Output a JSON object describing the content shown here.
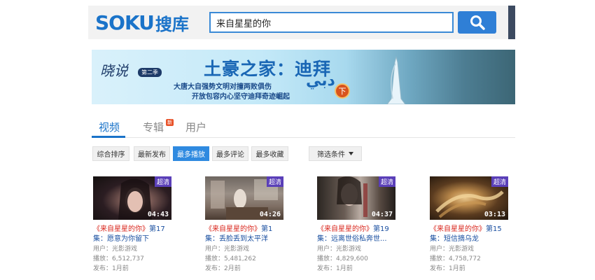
{
  "header": {
    "logo_latin": "SOKU",
    "logo_cn": "搜库",
    "search_value": "来自星星的你"
  },
  "banner": {
    "brand": "晓说",
    "badge": "第二季",
    "title": "土豪之家：迪拜",
    "line1": "大唐大自强势文明对撞两败俱伤",
    "line2": "开放包容内心坚守迪拜奇迹崛起",
    "arabic": "دبي",
    "down_label": "下"
  },
  "tabs": [
    {
      "label": "视频"
    },
    {
      "label": "专辑"
    },
    {
      "label": "用户"
    }
  ],
  "tab_badge": "新",
  "sort": [
    {
      "label": "综合排序"
    },
    {
      "label": "最新发布"
    },
    {
      "label": "最多播放"
    },
    {
      "label": "最多评论"
    },
    {
      "label": "最多收藏"
    }
  ],
  "filter_label": "筛选条件",
  "videos": [
    {
      "hd": "超清",
      "duration": "04:43",
      "title_hl": "《来自星星的你》",
      "title_rest": "第17集：愿意为你留下",
      "user": "用户：光影游戏",
      "plays": "播放：6,512,737",
      "published": "发布：1月前"
    },
    {
      "hd": "超清",
      "duration": "04:26",
      "title_hl": "《来自星星的你》",
      "title_rest": "第1集：丢脸丢到太平洋",
      "user": "用户：光影游戏",
      "plays": "播放：5,481,262",
      "published": "发布：2月前"
    },
    {
      "hd": "超清",
      "duration": "04:37",
      "title_hl": "《来自星星的你》",
      "title_rest": "第19集：远离世俗私奔世...",
      "user": "用户：光影游戏",
      "plays": "播放：4,829,600",
      "published": "发布：1月前"
    },
    {
      "hd": "超清",
      "duration": "03:13",
      "title_hl": "《来自星星的你》",
      "title_rest": "第15集：短信摘乌龙",
      "user": "用户：光影游戏",
      "plays": "播放：4,758,772",
      "published": "发布：1月前"
    }
  ],
  "colors": {
    "brand": "#1a73c9",
    "accent_button": "#2f8ae0",
    "highlight": "#d9261c",
    "hd_badge": "#5a3fb8"
  }
}
